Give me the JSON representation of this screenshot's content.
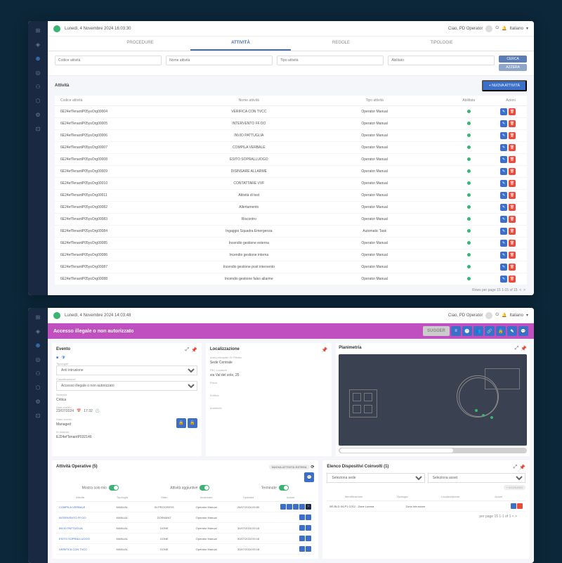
{
  "top": {
    "date": "Lunedì, 4 Novembre 2024 16:03:30",
    "greeting": "Ciao, PD Operator",
    "role": "Operator",
    "lang": "Italiano"
  },
  "tabs": {
    "procedure": "PROCEDURE",
    "attivita": "ATTIVITÀ",
    "regole": "REGOLE",
    "tipologie": "TIPOLOGIE"
  },
  "filters": {
    "code": "Codice attività",
    "name": "Nome attività",
    "type": "Tipo attività",
    "status": "Abilitato",
    "search": "CERCA",
    "reset": "AZZERA"
  },
  "section": {
    "title": "Attività",
    "new": "+ NUOVA ATTIVITÀ"
  },
  "thead": {
    "code": "Codice attività",
    "name": "Nome attività",
    "type": "Tipo attività",
    "status": "Abilitata",
    "actions": "Azioni"
  },
  "rows": [
    {
      "code": "6E24efTenantP05ysOrg00004",
      "name": "VERIFICA CON TVCC",
      "type": "Operator Manual"
    },
    {
      "code": "6E24efTenantP05ysOrg00005",
      "name": "INTERVENTO FF.OO",
      "type": "Operator Manual"
    },
    {
      "code": "6E24efTenantP05ysOrg00006",
      "name": "INVIO PATTUGLIA",
      "type": "Operator Manual"
    },
    {
      "code": "6E24efTenantP05ysOrg00007",
      "name": "COMPILA VERBALE",
      "type": "Operator Manual"
    },
    {
      "code": "6E24efTenantP05ysOrg00008",
      "name": "ESITO SOPRALLUOGO",
      "type": "Operator Manual"
    },
    {
      "code": "6E24efTenantP05ysOrg00009",
      "name": "DISINSARE ALLARME",
      "type": "Operator Manual"
    },
    {
      "code": "6E24efTenantP05ysOrg00010",
      "name": "CONTATTARE VVF",
      "type": "Operator Manual"
    },
    {
      "code": "6E24efTenantP05ysOrg00011",
      "name": "Attività di test",
      "type": "Operator Manual"
    },
    {
      "code": "6E24efTenantP05ysOrg00082",
      "name": "Allertamento",
      "type": "Operator Manual"
    },
    {
      "code": "6E24efTenantP05ysOrg00083",
      "name": "Riscontro",
      "type": "Operator Manual"
    },
    {
      "code": "6E24efTenantP05ysOrg00084",
      "name": "Ingaggio Squadra Emergenza",
      "type": "Automatic Task"
    },
    {
      "code": "6E24efTenantP05ysOrg00085",
      "name": "Incendio gestione esterna",
      "type": "Operator Manual"
    },
    {
      "code": "6E24efTenantP05ysOrg00086",
      "name": "Incendio gestione interna",
      "type": "Operator Manual"
    },
    {
      "code": "6E24efTenantP05ysOrg00087",
      "name": "Incendio gestione post intervento",
      "type": "Operator Manual"
    },
    {
      "code": "6E24efTenantP05ysOrg00088",
      "name": "Incendio gestione falso allarme",
      "type": "Operator Manual"
    }
  ],
  "pagination": "Rows per page 15   1-15 of 15",
  "s2": {
    "date": "Lunedì, 4 Novembre 2024 14:03:48",
    "banner": "Accesso illegale o non autorizzato",
    "btn_save": "SUGGER",
    "evento": {
      "title": "Evento",
      "tipologia_l": "Tipologia*",
      "tipologia": "Anti intrusione",
      "class_l": "Classificazione*",
      "class": "Accesso illegale o non autorizzato",
      "sev_l": "Severità",
      "sev": "Critica",
      "date_l": "Data evento",
      "date_v": "23/07/2024",
      "time_v": "17:32",
      "stato_l": "Stato evento",
      "stato": "Managed",
      "idall_l": "ID Allarme",
      "idall": "EJ24efTenantP032146"
    },
    "loc": {
      "title": "Localizzazione",
      "ent_l": "Area principale Di Filtrata",
      "ent": "Sede Centrale",
      "pb_l": "PB | Locatore",
      "pb": "via Val del sole, 25",
      "piano_l": "Piano",
      "edif_l": "Edificio",
      "amb_l": "Ambiente"
    },
    "plan": {
      "title": "Planimetria"
    },
    "ops": {
      "title": "Attività Operative (5)",
      "btn_refresh": "NUOVA ATTIVITÀ ESTESA",
      "tog1": "Mostra solo mio",
      "tog2": "Attività aggiuntive",
      "tog3": "Terminate",
      "head": {
        "a": "Attività",
        "t": "Tipologia",
        "s": "Stato",
        "i": "Incaricato",
        "u": "Updated",
        "ac": "Azioni"
      },
      "rows": [
        {
          "a": "COMPILA VERBALE",
          "t": "MANUAL",
          "s": "IN PROGRESS",
          "i": "Operator Manual",
          "u": "26/07/2024 09:50"
        },
        {
          "a": "INTERVENTO FF.OO",
          "t": "MANUAL",
          "s": "DORMANT",
          "i": "Operator Manual",
          "u": ""
        },
        {
          "a": "INVIO PATTUGLIA",
          "t": "MANUAL",
          "s": "DONE",
          "i": "Operator Manual",
          "u": "30/07/2024 09:18"
        },
        {
          "a": "ESITO SOPRALLUOGO",
          "t": "MANUAL",
          "s": "DONE",
          "i": "Operator Manual",
          "u": "30/07/2024 09:18"
        },
        {
          "a": "VERIFICA CON TVCC",
          "t": "MANUAL",
          "s": "DONE",
          "i": "Operator Manual",
          "u": "30/07/2024 09:18"
        }
      ]
    },
    "disp": {
      "title": "Elenco Dispositivi Coinvolti (1)",
      "sel1": "Seleziona sede",
      "sel2": "Seleziona asset",
      "btn_add": "+ AGGIUNGI",
      "head": {
        "id": "Identificazione",
        "t": "Tipologia",
        "l": "Localizzazione",
        "a": "Azioni"
      },
      "row": {
        "id": "BS BLD 04-P1 C012 - Zone Lorena",
        "t": "Zona Intrusione"
      },
      "pager": "per page 15   1-1 of 1"
    }
  }
}
